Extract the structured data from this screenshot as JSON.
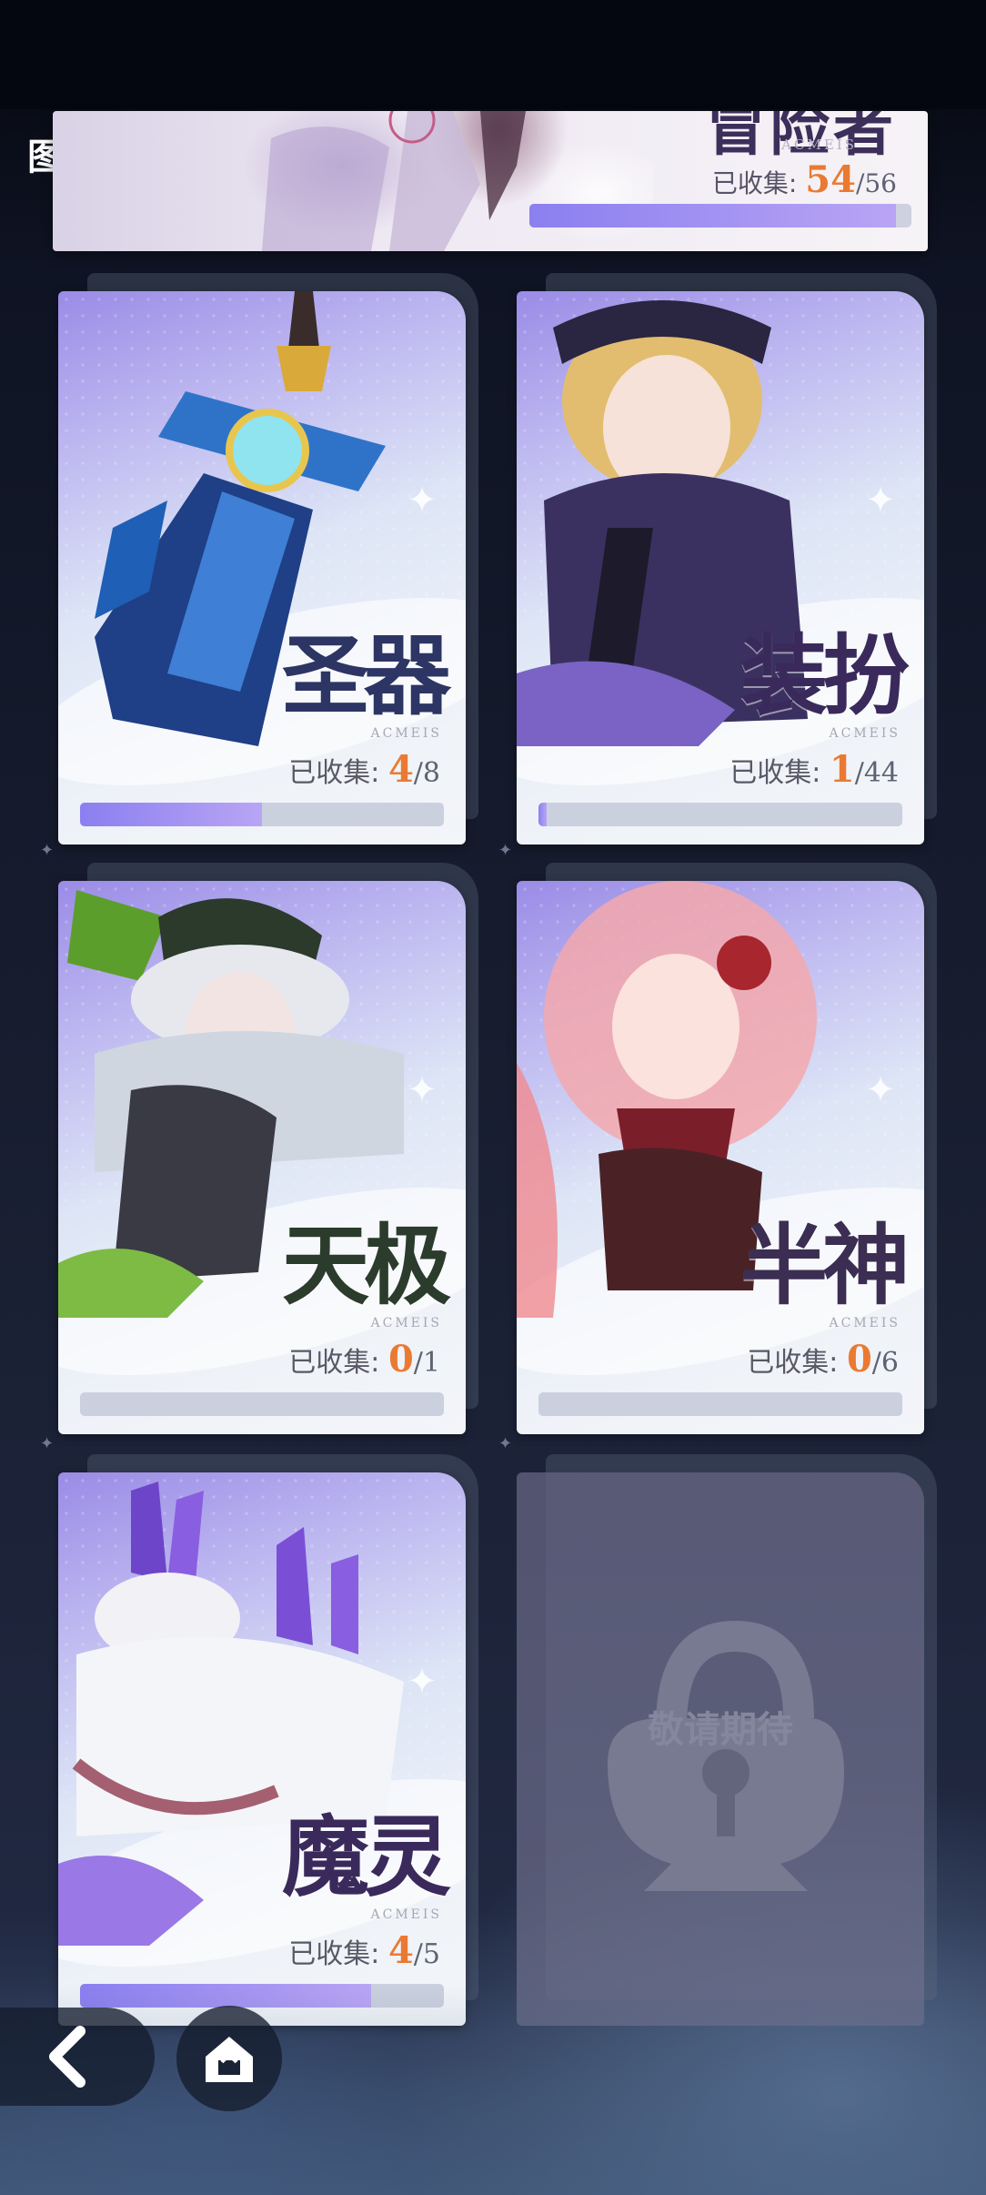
{
  "page": {
    "title": "图"
  },
  "banner": {
    "name": "冒险者",
    "subtitle": "ACMEIS",
    "collected_label": "已收集:",
    "collected": "54",
    "total": "/56",
    "progress": 0.96
  },
  "cards": [
    {
      "name": "圣器",
      "subtitle": "ACMEIS",
      "collected_label": "已收集:",
      "collected": "4",
      "total": "/8",
      "progress": 0.5,
      "name_color": "#2c3563"
    },
    {
      "name": "装扮",
      "subtitle": "ACMEIS",
      "collected_label": "已收集:",
      "collected": "1",
      "total": "/44",
      "progress": 0.023,
      "name_color": "#3a2a5c"
    },
    {
      "name": "天极",
      "subtitle": "ACMEIS",
      "collected_label": "已收集:",
      "collected": "0",
      "total": "/1",
      "progress": 0,
      "name_color": "#2b3b2c"
    },
    {
      "name": "半神",
      "subtitle": "ACMEIS",
      "collected_label": "已收集:",
      "collected": "0",
      "total": "/6",
      "progress": 0,
      "name_color": "#3b2e52"
    },
    {
      "name": "魔灵",
      "subtitle": "ACMEIS",
      "collected_label": "已收集:",
      "collected": "4",
      "total": "/5",
      "progress": 0.8,
      "name_color": "#3a2a5c"
    }
  ],
  "locked_card": {
    "label": "敬请期待"
  },
  "nav": {
    "back_icon": "chevron-left-icon",
    "home_icon": "home-icon"
  },
  "colors": {
    "accent_orange": "#ea7a33",
    "progress_purple": "#8b7ff0",
    "background": "#0b0f1d"
  }
}
